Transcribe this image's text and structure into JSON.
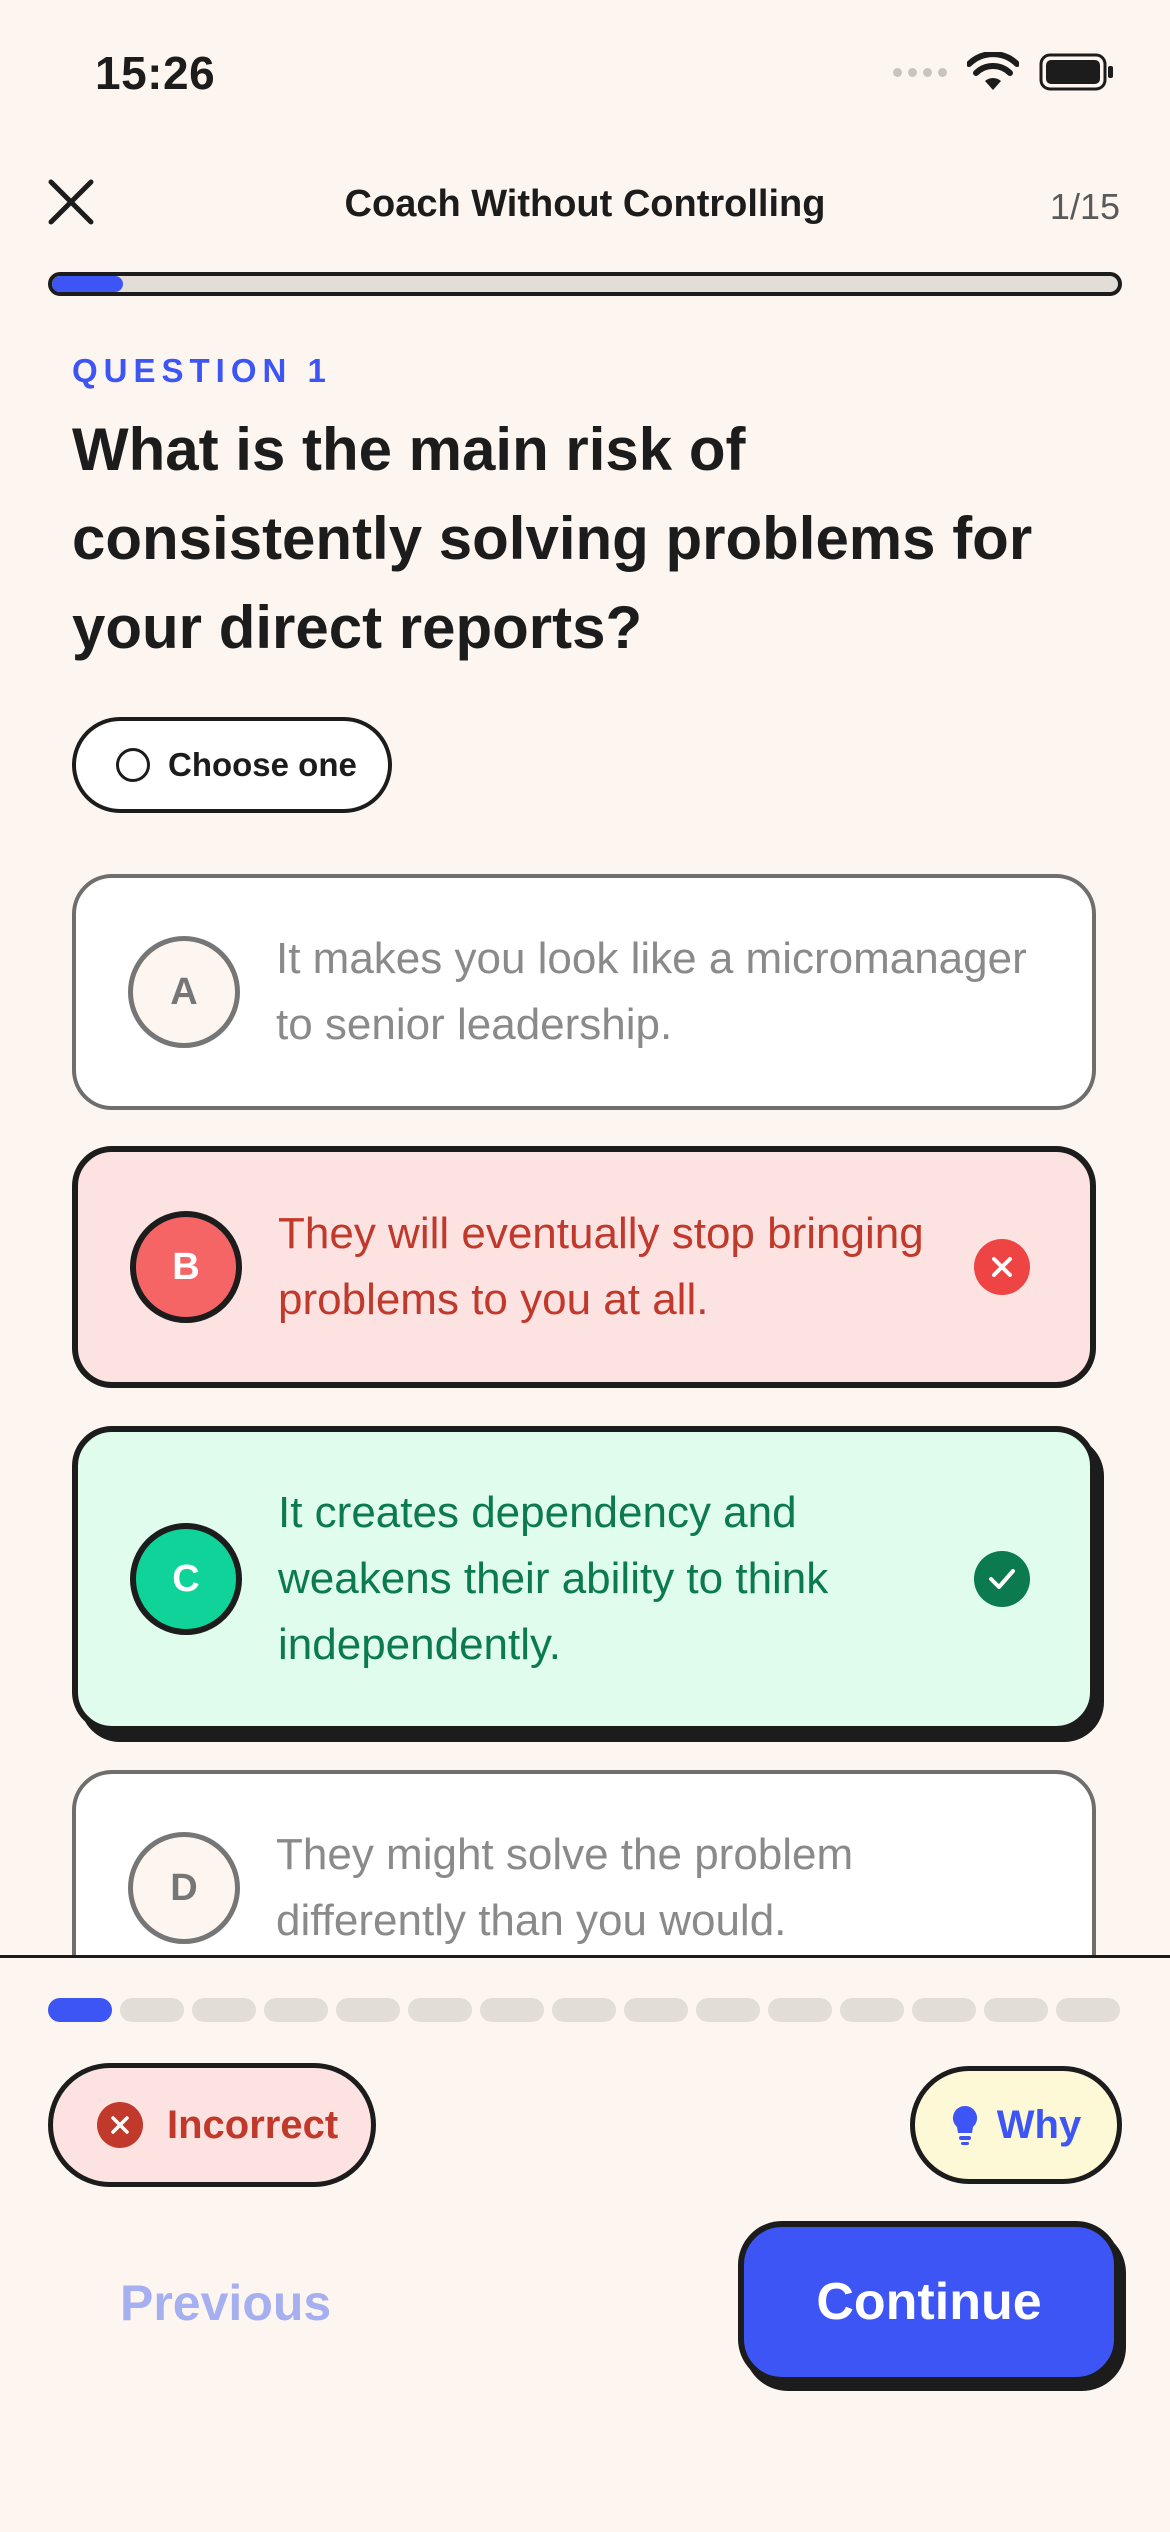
{
  "status_bar": {
    "time": "15:26"
  },
  "header": {
    "title": "Coach Without Controlling",
    "count": "1/15"
  },
  "progress": {
    "current": 1,
    "total": 15,
    "fraction": 0.067
  },
  "question": {
    "label": "QUESTION 1",
    "text": "What is the main risk of consistently solving problems for your direct reports?",
    "instruction": "Choose one"
  },
  "options": [
    {
      "letter": "A",
      "text": "It makes you look like a micromanager to senior leadership.",
      "state": "neutral"
    },
    {
      "letter": "B",
      "text": "They will eventually stop bringing problems to you at all.",
      "state": "incorrect"
    },
    {
      "letter": "C",
      "text": "It creates dependency and weakens their ability to think independently.",
      "state": "correct"
    },
    {
      "letter": "D",
      "text": "They might solve the problem differently than you would.",
      "state": "neutral"
    }
  ],
  "bottom": {
    "result_label": "Incorrect",
    "why_label": "Why",
    "previous_label": "Previous",
    "continue_label": "Continue"
  },
  "colors": {
    "accent": "#3d55f5",
    "incorrect": "#ef4444",
    "correct": "#10d39a",
    "background": "#fdf6f0"
  }
}
